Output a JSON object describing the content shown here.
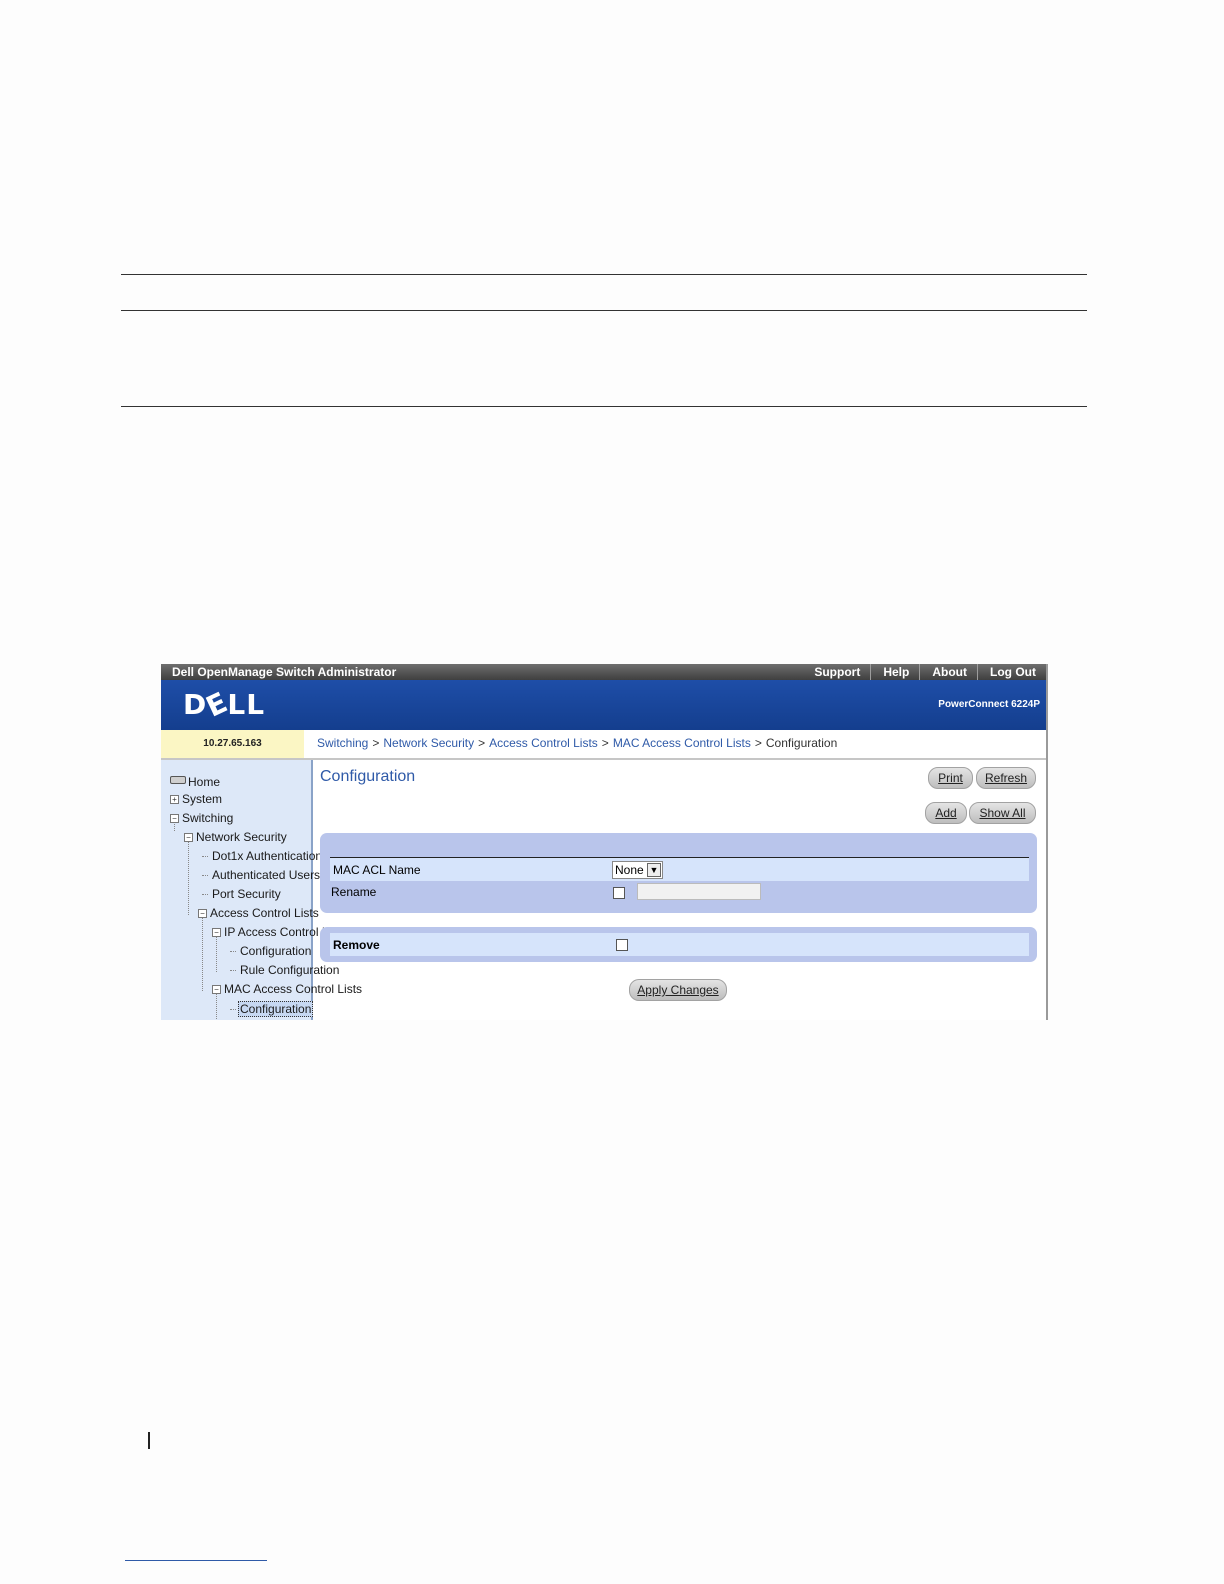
{
  "app": {
    "title": "Dell OpenManage Switch Administrator",
    "top_links": [
      "Support",
      "Help",
      "About",
      "Log Out"
    ],
    "logo": "DELL",
    "model": "PowerConnect 6224P",
    "ip": "10.27.65.163"
  },
  "breadcrumb": {
    "items": [
      "Switching",
      "Network Security",
      "Access Control Lists",
      "MAC Access Control Lists",
      "Configuration"
    ],
    "separator": ">"
  },
  "sidebar": {
    "items": [
      {
        "label": "Home",
        "icon": "home-icon"
      },
      {
        "label": "System",
        "toggle": "+"
      },
      {
        "label": "Switching",
        "toggle": "−"
      },
      {
        "label": "Network Security",
        "toggle": "−"
      },
      {
        "label": "Dot1x Authentication"
      },
      {
        "label": "Authenticated Users"
      },
      {
        "label": "Port Security"
      },
      {
        "label": "Access Control Lists",
        "toggle": "−"
      },
      {
        "label": "IP Access Control Lists",
        "toggle": "−"
      },
      {
        "label": "Configuration"
      },
      {
        "label": "Rule Configuration"
      },
      {
        "label": "MAC Access Control Lists",
        "toggle": "−"
      },
      {
        "label": "Configuration",
        "selected": true
      }
    ]
  },
  "main": {
    "title": "Configuration",
    "buttons": {
      "print": "Print",
      "refresh": "Refresh",
      "add": "Add",
      "show_all": "Show All",
      "apply": "Apply Changes"
    },
    "form": {
      "mac_acl_name_label": "MAC ACL Name",
      "mac_acl_name_value": "None",
      "rename_label": "Rename",
      "rename_value": "",
      "remove_label": "Remove"
    }
  }
}
